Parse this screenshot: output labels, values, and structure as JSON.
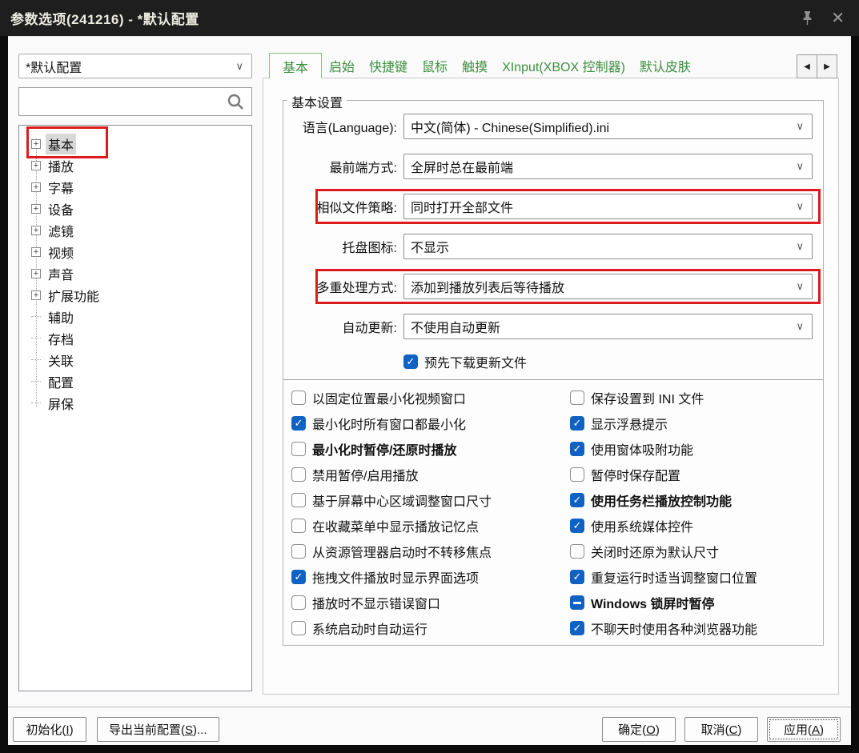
{
  "window": {
    "title": "参数选项(241216) - *默认配置"
  },
  "titlebar": {
    "icons": [
      "pushpin",
      "close"
    ],
    "close_glyph": "✕"
  },
  "sidebar": {
    "profile_value": "*默认配置",
    "search_value": "",
    "tree_items": [
      {
        "label": "基本",
        "expandable": true,
        "selected": true,
        "annotated": true
      },
      {
        "label": "播放",
        "expandable": true
      },
      {
        "label": "字幕",
        "expandable": true
      },
      {
        "label": "设备",
        "expandable": true
      },
      {
        "label": "滤镜",
        "expandable": true
      },
      {
        "label": "视频",
        "expandable": true
      },
      {
        "label": "声音",
        "expandable": true
      },
      {
        "label": "扩展功能",
        "expandable": true
      },
      {
        "label": "辅助"
      },
      {
        "label": "存档"
      },
      {
        "label": "关联"
      },
      {
        "label": "配置"
      },
      {
        "label": "屏保"
      }
    ]
  },
  "tabs": {
    "items": [
      {
        "label": "基本",
        "active": true
      },
      {
        "label": "启始"
      },
      {
        "label": "快捷键"
      },
      {
        "label": "鼠标"
      },
      {
        "label": "触摸"
      },
      {
        "label": "XInput(XBOX 控制器)"
      },
      {
        "label": "默认皮肤"
      }
    ],
    "scroll_left": "◀",
    "scroll_right": "▶"
  },
  "main": {
    "group_title": "基本设置",
    "dropdown_rows": [
      {
        "label": "语言(Language):",
        "value": "中文(简体) - Chinese(Simplified).ini",
        "annotated": false
      },
      {
        "label": "最前端方式:",
        "value": "全屏时总在最前端",
        "annotated": false
      },
      {
        "label": "相似文件策略:",
        "value": "同时打开全部文件",
        "annotated": true
      },
      {
        "label": "托盘图标:",
        "value": "不显示",
        "annotated": false
      },
      {
        "label": "多重处理方式:",
        "value": "添加到播放列表后等待播放",
        "annotated": true
      },
      {
        "label": "自动更新:",
        "value": "不使用自动更新",
        "annotated": false
      }
    ],
    "predownload_checkbox": {
      "label": "预先下载更新文件",
      "state": "checked"
    },
    "checkbox_left": [
      {
        "label": "以固定位置最小化视频窗口",
        "state": "unchecked"
      },
      {
        "label": "最小化时所有窗口都最小化",
        "state": "checked"
      },
      {
        "label": "最小化时暂停/还原时播放",
        "state": "unchecked",
        "bold": true
      },
      {
        "label": "禁用暂停/启用播放",
        "state": "unchecked"
      },
      {
        "label": "基于屏幕中心区域调整窗口尺寸",
        "state": "unchecked"
      },
      {
        "label": "在收藏菜单中显示播放记忆点",
        "state": "unchecked"
      },
      {
        "label": "从资源管理器启动时不转移焦点",
        "state": "unchecked"
      },
      {
        "label": "拖拽文件播放时显示界面选项",
        "state": "checked"
      },
      {
        "label": "播放时不显示错误窗口",
        "state": "unchecked"
      },
      {
        "label": "系统启动时自动运行",
        "state": "unchecked"
      }
    ],
    "checkbox_right": [
      {
        "label": "保存设置到 INI 文件",
        "state": "unchecked"
      },
      {
        "label": "显示浮悬提示",
        "state": "checked"
      },
      {
        "label": "使用窗体吸附功能",
        "state": "checked"
      },
      {
        "label": "暂停时保存配置",
        "state": "unchecked"
      },
      {
        "label": "使用任务栏播放控制功能",
        "state": "checked",
        "bold": true
      },
      {
        "label": "使用系统媒体控件",
        "state": "checked"
      },
      {
        "label": "关闭时还原为默认尺寸",
        "state": "unchecked"
      },
      {
        "label": "重复运行时适当调整窗口位置",
        "state": "checked"
      },
      {
        "label": "Windows 锁屏时暂停",
        "state": "indeterminate",
        "bold": true
      },
      {
        "label": "不聊天时使用各种浏览器功能",
        "state": "checked"
      }
    ]
  },
  "footer": {
    "left_buttons": [
      {
        "label": "初始化(I)"
      },
      {
        "label": "导出当前配置(S)..."
      }
    ],
    "right_buttons": [
      {
        "label": "确定(O)"
      },
      {
        "label": "取消(C)"
      },
      {
        "label": "应用(A)",
        "focused": true
      }
    ]
  },
  "colors": {
    "accent_blue": "#0f62c3",
    "tab_green": "#3e8e41",
    "annotation_red": "#dc1c1c",
    "titlebar_bg": "#1e1e1e"
  }
}
